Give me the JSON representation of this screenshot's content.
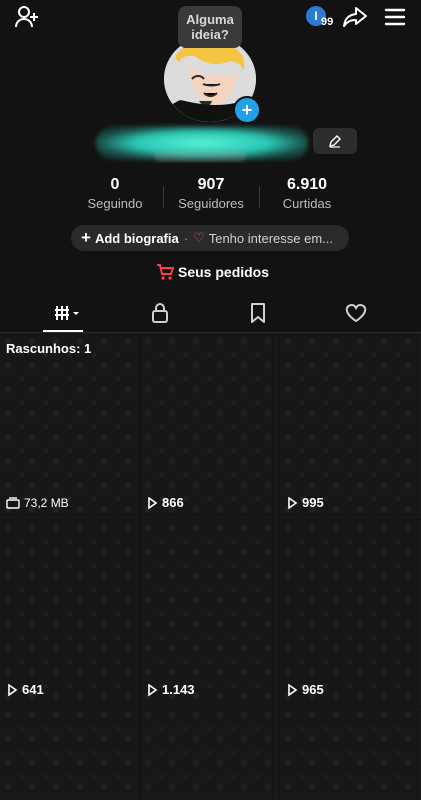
{
  "header": {
    "notification_count": "99",
    "icons": [
      "add-friend-icon",
      "notification-icon",
      "share-icon",
      "menu-icon"
    ],
    "avatar_tooltip": "Alguma\nideia?"
  },
  "profile": {
    "stats": [
      {
        "value": "0",
        "label": "Seguindo"
      },
      {
        "value": "907",
        "label": "Seguidores"
      },
      {
        "value": "6.910",
        "label": "Curtidas"
      }
    ],
    "bio": {
      "add_label": "Add biografia",
      "separator": "·",
      "interest_label": "Tenho interesse em..."
    },
    "orders_label": "Seus pedidos"
  },
  "tabs": [
    {
      "name": "videos",
      "active": true
    },
    {
      "name": "private"
    },
    {
      "name": "saved"
    },
    {
      "name": "liked"
    }
  ],
  "grid": {
    "drafts_label": "Rascunhos: 1",
    "draft_size": "73,2 MB",
    "views": [
      "866",
      "995",
      "641",
      "1.143",
      "965"
    ]
  },
  "colors": {
    "background": "#121212",
    "accent": "#24a0e6",
    "heart": "#ff5a6e",
    "cart": "#ff3b4f"
  }
}
